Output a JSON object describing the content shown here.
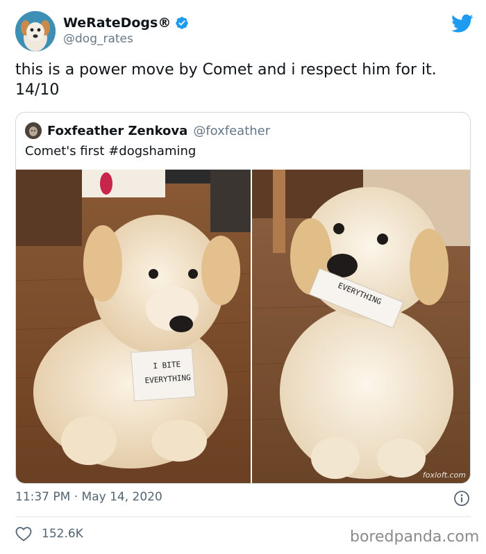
{
  "tweet": {
    "author": {
      "display_name": "WeRateDogs®",
      "handle": "@dog_rates",
      "verified": true,
      "avatar_icon": "dog-avatar"
    },
    "text": "this is a power move by Comet and i respect him for it. 14/10",
    "timestamp": "11:37 PM · May 14, 2020",
    "like_count": "152.6K"
  },
  "quote": {
    "display_name": "Foxfeather Zenkova",
    "handle": "@foxfeather",
    "text": "Comet's first #dogshaming",
    "photos": [
      {
        "sign_line1": "I BITE",
        "sign_line2": "EVERYTHING"
      },
      {
        "sign_text": "EVERYTHING",
        "watermark": "foxloft.com"
      }
    ]
  },
  "footer": {
    "brand": "boredpanda.com"
  },
  "colors": {
    "twitter_blue": "#1d9bf0",
    "text": "#0f1419",
    "muted": "#536471",
    "border": "#cfd9de"
  }
}
